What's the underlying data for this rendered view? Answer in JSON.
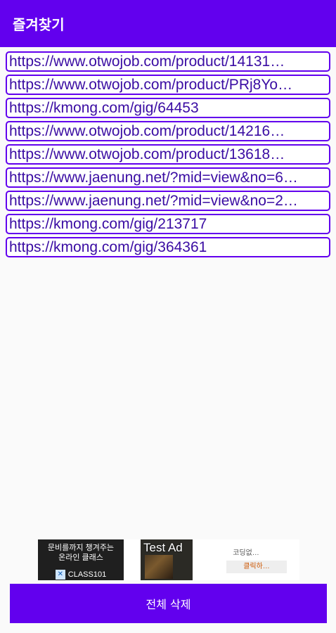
{
  "appbar": {
    "title": "즐겨찾기"
  },
  "favorites": [
    "https://www.otwojob.com/product/14131…",
    "https://www.otwojob.com/product/PRj8Yo…",
    "https://kmong.com/gig/64453",
    "https://www.otwojob.com/product/14216…",
    "https://www.otwojob.com/product/13618…",
    "https://www.jaenung.net/?mid=view&no=6…",
    "https://www.jaenung.net/?mid=view&no=2…",
    "https://kmong.com/gig/213717",
    "https://kmong.com/gig/364361"
  ],
  "ad": {
    "left_line1": "문비를까지 챙겨주는",
    "left_line2": "온라인 클래스",
    "brand": "CLASS101",
    "test_label": "Test Ad",
    "right_top": "코딩없…",
    "right_button": "클릭하…"
  },
  "bottom_button": {
    "label": "전체 삭제"
  },
  "colors": {
    "primary": "#6200ee",
    "link_text": "#3a0ca3",
    "background": "#fafafa"
  }
}
